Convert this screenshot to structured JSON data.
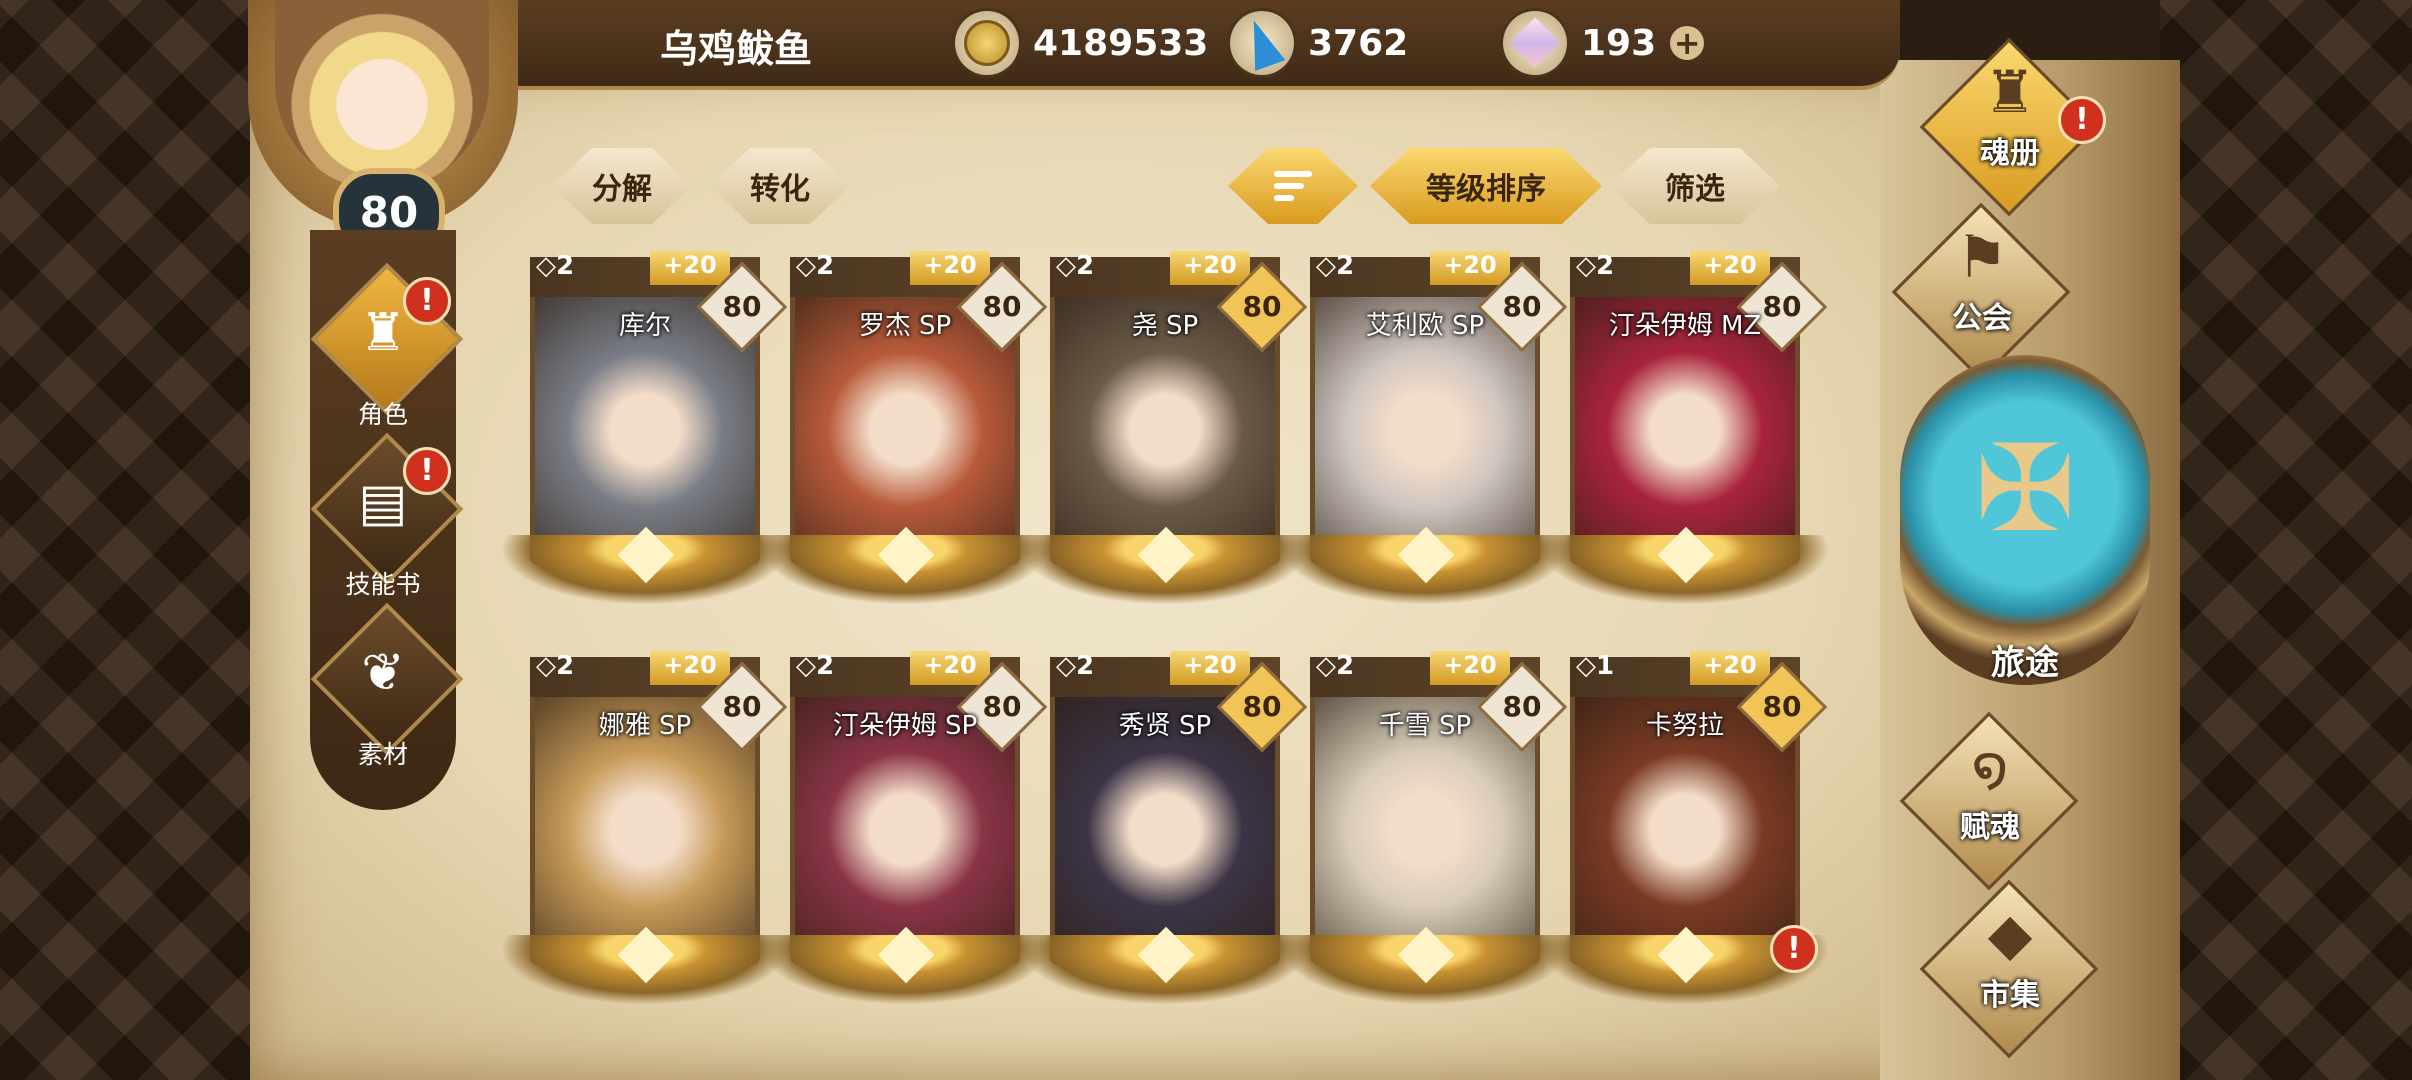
{
  "player": {
    "name": "乌鸡鲅鱼",
    "level": "80"
  },
  "currencies": [
    {
      "icon": "gold-coin-icon",
      "value": "4189533"
    },
    {
      "icon": "blue-crystal-icon",
      "value": "3762"
    },
    {
      "icon": "pink-gem-icon",
      "value": "193"
    }
  ],
  "left_nav": [
    {
      "label": "角色",
      "icon": "character-helmet-icon",
      "alert": true
    },
    {
      "label": "技能书",
      "icon": "skill-book-icon",
      "alert": true
    },
    {
      "label": "素材",
      "icon": "material-icon",
      "alert": false
    }
  ],
  "toolbar": {
    "decompose": "分解",
    "convert": "转化",
    "sort_level": "等级排序",
    "filter": "筛选"
  },
  "cards": [
    {
      "star": "◇2",
      "bonus": "+20",
      "level": "80",
      "name": "库尔",
      "color": "#7a7d86"
    },
    {
      "star": "◇2",
      "bonus": "+20",
      "level": "80",
      "name": "罗杰 SP",
      "color": "#b85a3a"
    },
    {
      "star": "◇2",
      "bonus": "+20",
      "level": "80",
      "name": "尧 SP",
      "color": "#6a5a48"
    },
    {
      "star": "◇2",
      "bonus": "+20",
      "level": "80",
      "name": "艾利欧 SP",
      "color": "#cfc6c0"
    },
    {
      "star": "◇2",
      "bonus": "+20",
      "level": "80",
      "name": "汀朵伊姆 MZ",
      "color": "#a8243c"
    },
    {
      "star": "◇2",
      "bonus": "+20",
      "level": "80",
      "name": "娜雅 SP",
      "color": "#c79a58"
    },
    {
      "star": "◇2",
      "bonus": "+20",
      "level": "80",
      "name": "汀朵伊姆 SP",
      "color": "#8a3446"
    },
    {
      "star": "◇2",
      "bonus": "+20",
      "level": "80",
      "name": "秀贤 SP",
      "color": "#3c3446"
    },
    {
      "star": "◇2",
      "bonus": "+20",
      "level": "80",
      "name": "千雪 SP",
      "color": "#d8ccb8"
    },
    {
      "star": "◇1",
      "bonus": "+20",
      "level": "80",
      "name": "卡努拉",
      "color": "#7a3a24"
    }
  ],
  "right_menu": [
    {
      "label": "魂册",
      "icon": "soul-book-icon",
      "alert": true
    },
    {
      "label": "公会",
      "icon": "guild-flag-icon",
      "alert": false
    },
    {
      "label": "旅途",
      "icon": "journey-emblem-icon",
      "alert": false
    },
    {
      "label": "赋魂",
      "icon": "soul-swirl-icon",
      "alert": false
    },
    {
      "label": "市集",
      "icon": "market-gem-icon",
      "alert": false
    }
  ]
}
